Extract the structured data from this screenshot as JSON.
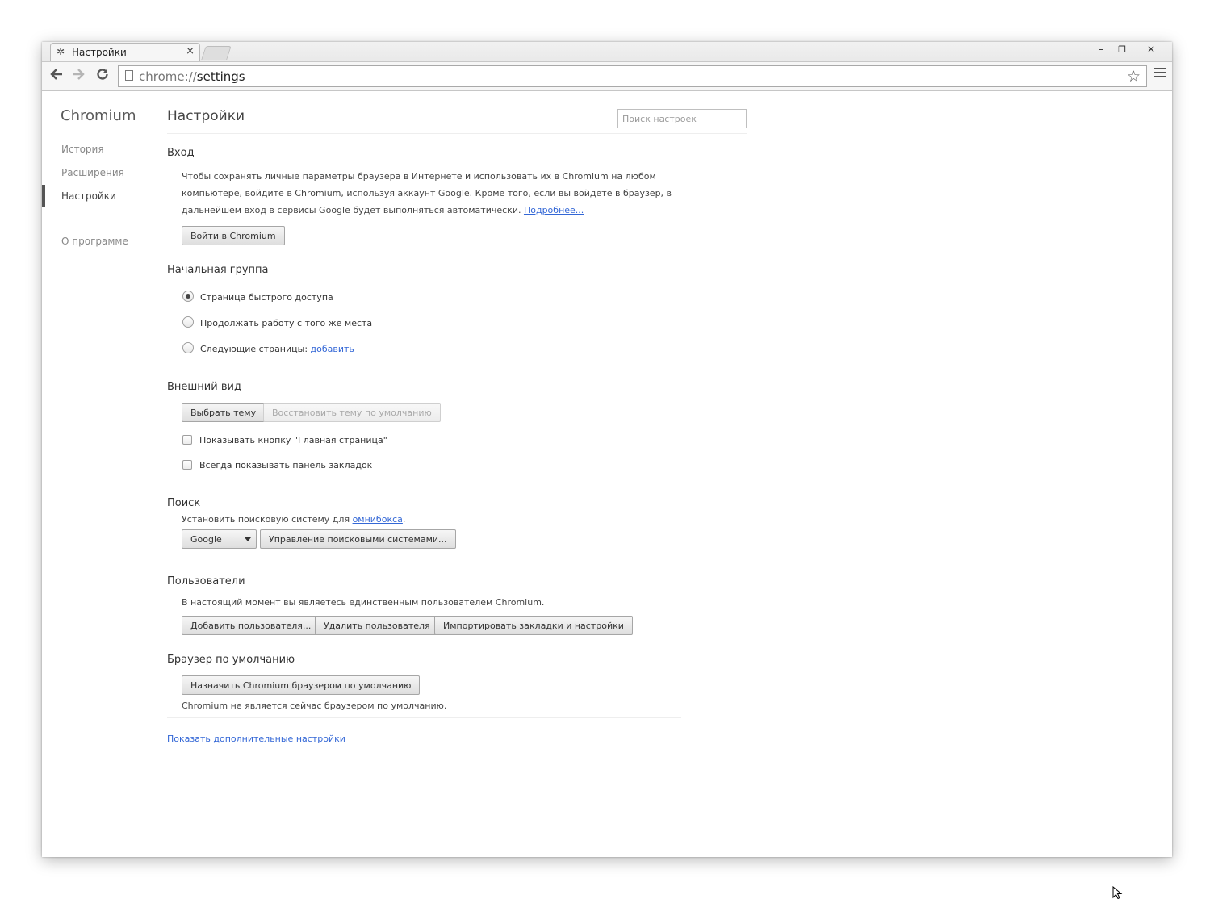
{
  "tab": {
    "title": "Настройки",
    "icon": "gear-icon",
    "close": "×"
  },
  "window_controls": {
    "minimize": "–",
    "maximize": "❐",
    "close": "✕"
  },
  "omnibox": {
    "scheme": "chrome://",
    "path": "settings"
  },
  "sidebar": {
    "brand": "Chromium",
    "items": [
      {
        "label": "История",
        "selected": false
      },
      {
        "label": "Расширения",
        "selected": false
      },
      {
        "label": "Настройки",
        "selected": true
      },
      {
        "label": "О программе",
        "selected": false
      }
    ]
  },
  "main": {
    "title": "Настройки",
    "search_placeholder": "Поиск настроек",
    "signin": {
      "title": "Вход",
      "text_1": "Чтобы сохранять личные параметры браузера в Интернете и использовать их в Chromium на любом",
      "text_2": "компьютере, войдите в Chromium, используя аккаунт Google. Кроме того, если вы войдете в браузер, в",
      "text_3": "дальнейшем вход в сервисы Google будет выполняться автоматически.",
      "learn_more": "Подробнее...",
      "button": "Войти в Chromium"
    },
    "startup": {
      "title": "Начальная группа",
      "options": [
        {
          "label": "Страница быстрого доступа",
          "selected": true
        },
        {
          "label": "Продолжать работу с того же места",
          "selected": false
        },
        {
          "label": "Следующие страницы:",
          "selected": false
        }
      ],
      "add_link": "добавить"
    },
    "appearance": {
      "title": "Внешний вид",
      "choose_theme": "Выбрать тему",
      "reset_theme": "Восстановить тему по умолчанию",
      "show_home": "Показывать кнопку \"Главная страница\"",
      "show_bookmarks": "Всегда показывать панель закладок",
      "show_home_checked": false,
      "show_bookmarks_checked": false
    },
    "search": {
      "title": "Поиск",
      "text": "Установить поисковую систему для",
      "omnibox_link": "омнибокса",
      "text_end": ".",
      "engine": "Google",
      "manage": "Управление поисковыми системами..."
    },
    "users": {
      "title": "Пользователи",
      "text": "В настоящий момент вы являетесь единственным пользователем Chromium.",
      "add": "Добавить пользователя...",
      "remove": "Удалить пользователя",
      "import": "Импортировать закладки и настройки"
    },
    "default_browser": {
      "title": "Браузер по умолчанию",
      "button": "Назначить Chromium браузером по умолчанию",
      "status": "Chromium не является сейчас браузером по умолчанию."
    },
    "advanced_link": "Показать дополнительные настройки"
  }
}
